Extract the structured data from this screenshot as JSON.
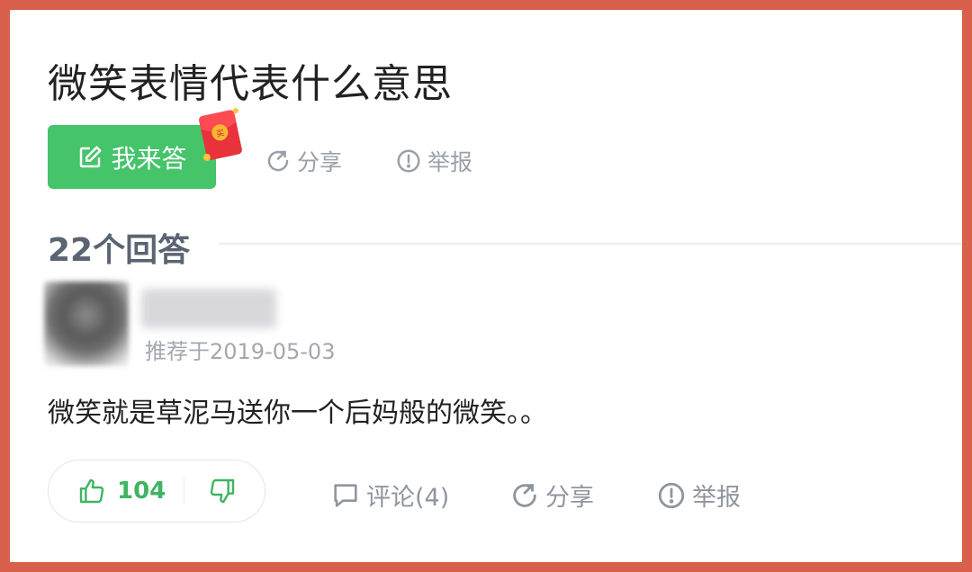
{
  "question": {
    "title": "微笑表情代表什么意思",
    "answer_button_label": "我来答",
    "share_label": "分享",
    "report_label": "举报",
    "red_packet_icon": "red-packet-icon",
    "red_packet_mark": "买"
  },
  "answers": {
    "count_label": "22个回答"
  },
  "answer": {
    "username": "",
    "recommended_date": "推荐于2019-05-03",
    "text": "微笑就是草泥马送你一个后妈般的微笑。。",
    "likes": "104",
    "comment_label": "评论(4)",
    "share_label": "分享",
    "report_label": "举报"
  },
  "colors": {
    "frame": "#d9604b",
    "accent_green": "#45c46a",
    "muted": "#9aa0a8"
  }
}
